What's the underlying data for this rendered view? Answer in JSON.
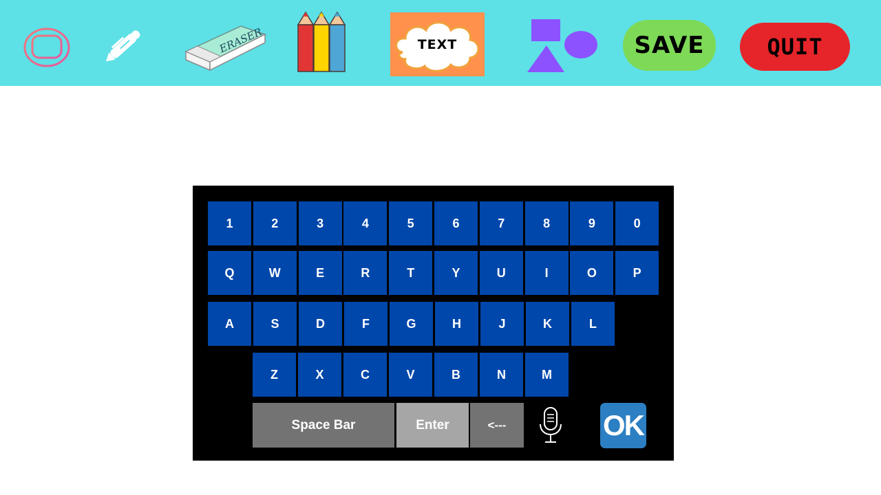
{
  "toolbar": {
    "icons": [
      "chat-bubble-icon",
      "pen-icon",
      "eraser-icon",
      "colored-pencils-icon",
      "text-cloud-icon",
      "shapes-icon"
    ],
    "eraser_text": "ERASER",
    "text_tool_label": "TEXT",
    "save_label": "SAVE",
    "quit_label": "QUIT",
    "colors": {
      "bar": "#5de0e6",
      "save": "#7ed957",
      "quit": "#e5252a",
      "text_bg": "#ff914d",
      "shapes": "#8c52ff"
    }
  },
  "keyboard": {
    "rows": [
      [
        "1",
        "2",
        "3",
        "4",
        "5",
        "6",
        "7",
        "8",
        "9",
        "0"
      ],
      [
        "Q",
        "W",
        "E",
        "R",
        "T",
        "Y",
        "U",
        "I",
        "O",
        "P"
      ],
      [
        "A",
        "S",
        "D",
        "F",
        "G",
        "H",
        "J",
        "K",
        "L"
      ],
      [
        "Z",
        "X",
        "C",
        "V",
        "B",
        "N",
        "M"
      ]
    ],
    "space_label": "Space Bar",
    "enter_label": "Enter",
    "backspace_label": "<---",
    "mic_icon": "microphone-icon",
    "ok_label": "OK",
    "colors": {
      "key": "#0047ab",
      "background": "#000000",
      "space": "#737373",
      "enter": "#a6a6a6",
      "ok": "#2c7fc2"
    }
  }
}
